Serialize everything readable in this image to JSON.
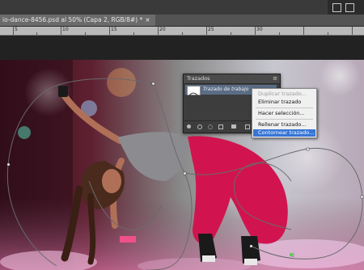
{
  "document": {
    "tab_title": "io-dance-8456.psd al 50% (Capa 2, RGB/8#) *",
    "close_label": "×"
  },
  "ruler": {
    "labels": [
      "5",
      "10",
      "15",
      "20",
      "25",
      "30"
    ]
  },
  "paths_panel": {
    "title": "Trazados",
    "menu_icon": "≡",
    "active_path": "Trazado de trabajo"
  },
  "context_menu": {
    "items": [
      {
        "label": "Duplicar trazado...",
        "state": "disabled"
      },
      {
        "label": "Eliminar trazado",
        "state": "normal"
      },
      {
        "label": "Hacer selección...",
        "state": "normal"
      },
      {
        "label": "Rellenar trazado...",
        "state": "normal"
      },
      {
        "label": "Contornear trazado...",
        "state": "selected"
      }
    ]
  },
  "colors": {
    "ui_dark": "#282828",
    "panel_bg": "#3d3d3d",
    "selection_blue": "#3875d6",
    "path_row": "#5b6d86",
    "pants_red": "#d1144f"
  },
  "icons": [
    "close-icon",
    "panel-menu-icon",
    "fill-path-icon",
    "stroke-path-icon",
    "load-selection-icon",
    "make-path-icon",
    "add-mask-icon",
    "new-path-icon",
    "delete-path-icon"
  ]
}
